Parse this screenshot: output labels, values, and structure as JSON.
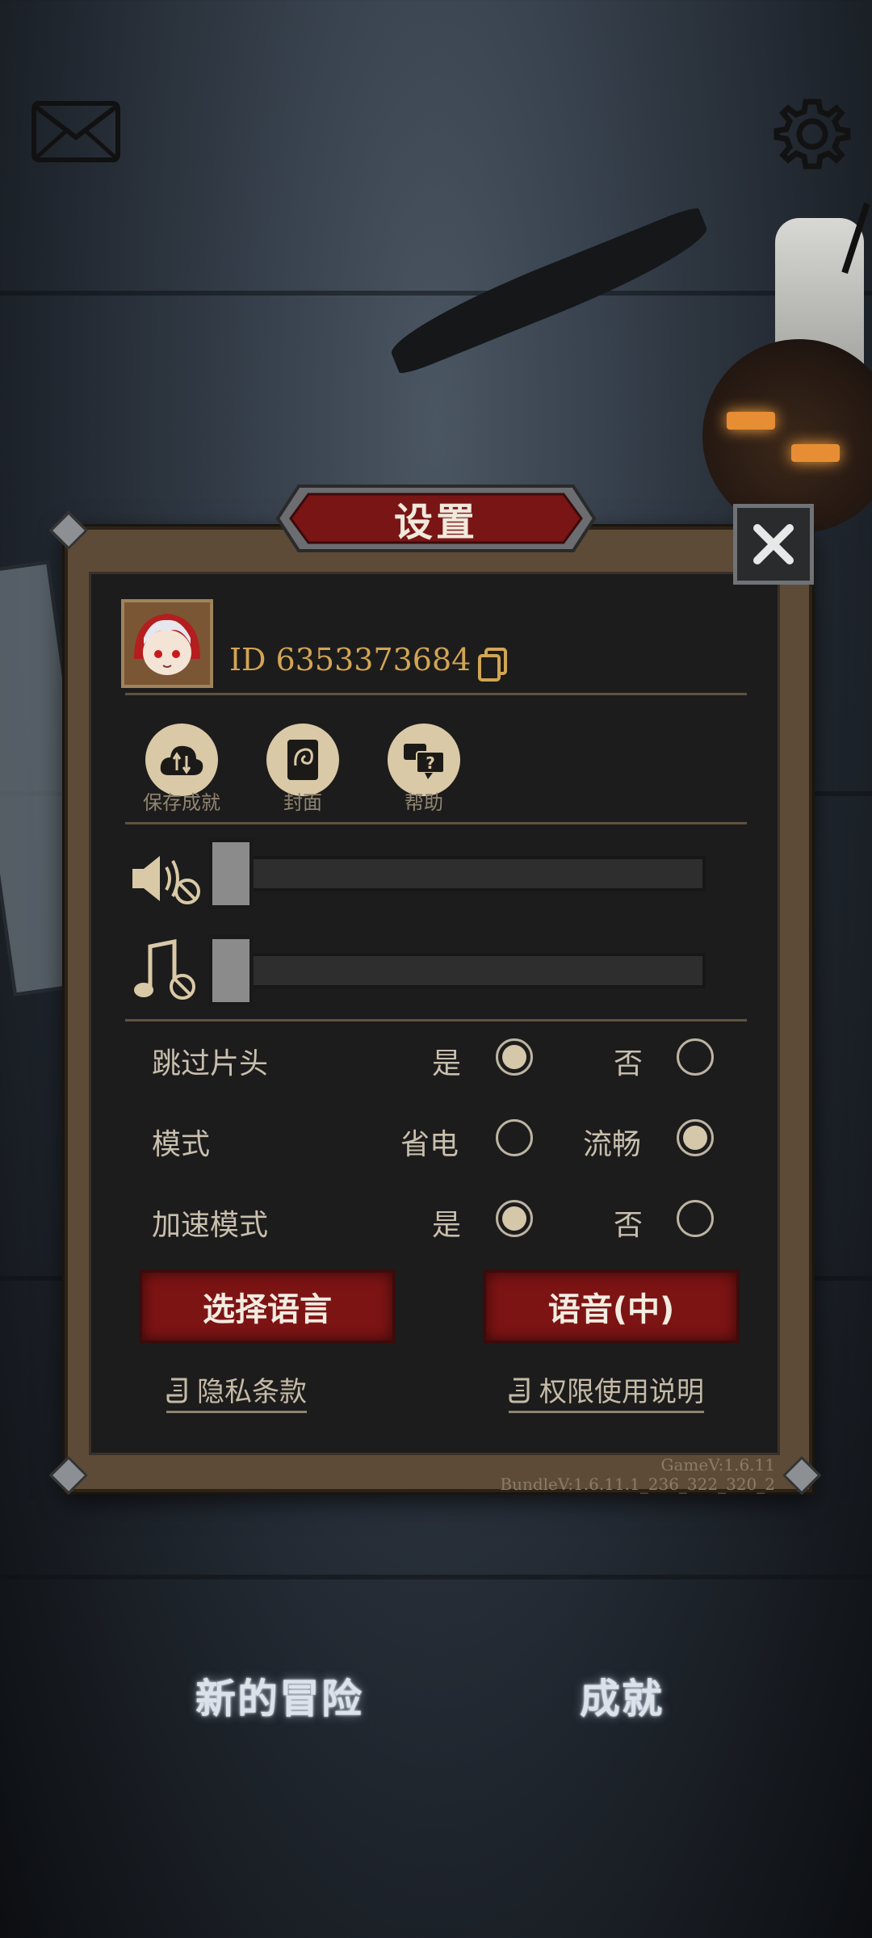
{
  "panel": {
    "title": "设置",
    "player_id": "ID 6353373684"
  },
  "actions": [
    {
      "label": "保存成就",
      "icon": "cloud-sync-icon"
    },
    {
      "label": "封面",
      "icon": "cover-book-icon"
    },
    {
      "label": "帮助",
      "icon": "help-chat-icon"
    }
  ],
  "volume": {
    "sound_level": 0,
    "music_level": 0
  },
  "options": [
    {
      "label": "跳过片头",
      "choice_a": "是",
      "choice_b": "否",
      "selected": "a"
    },
    {
      "label": "模式",
      "choice_a": "省电",
      "choice_b": "流畅",
      "selected": "b"
    },
    {
      "label": "加速模式",
      "choice_a": "是",
      "choice_b": "否",
      "selected": "a"
    }
  ],
  "buttons": {
    "select_language": "选择语言",
    "voice": "语音(中)"
  },
  "links": {
    "privacy": "隐私条款",
    "permissions": "权限使用说明"
  },
  "version": "GameV:1.6.11 BundleV:1.6.11.1_236_322_320_2",
  "main_menu": {
    "new_adventure": "新的冒险",
    "achievements": "成就"
  },
  "colors": {
    "accent_red": "#7d1414",
    "id_gold": "#d2a554",
    "panel_bg": "#1d1c1c"
  }
}
